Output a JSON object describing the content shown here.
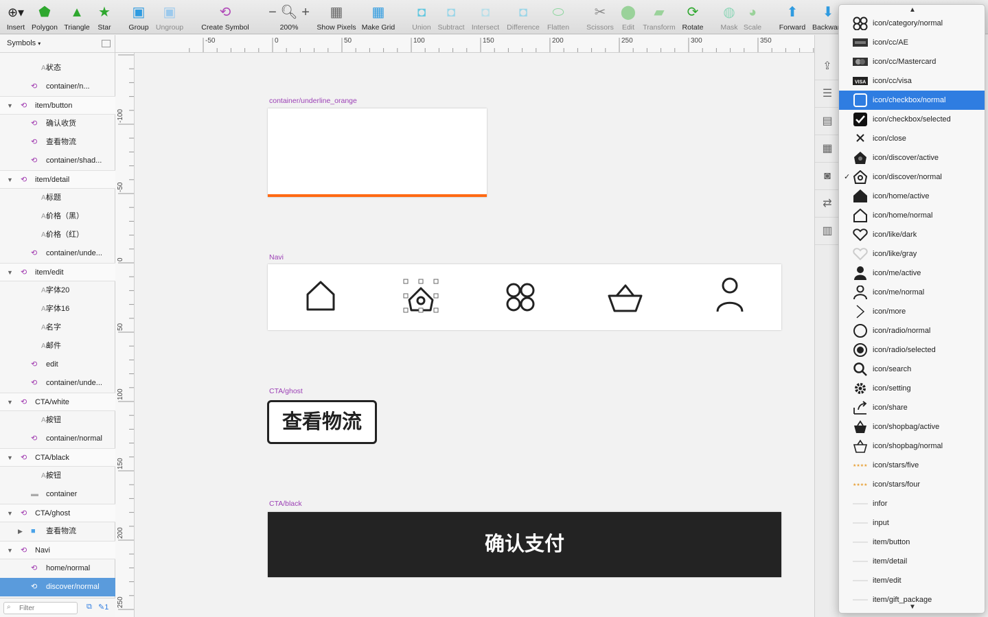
{
  "toolbar": {
    "insert": "Insert",
    "polygon": "Polygon",
    "triangle": "Triangle",
    "star": "Star",
    "group": "Group",
    "ungroup": "Ungroup",
    "create_symbol": "Create Symbol",
    "zoom": "200%",
    "show_pixels": "Show Pixels",
    "make_grid": "Make Grid",
    "union": "Union",
    "subtract": "Subtract",
    "intersect": "Intersect",
    "difference": "Difference",
    "flatten": "Flatten",
    "scissors": "Scissors",
    "edit": "Edit",
    "transform": "Transform",
    "rotate": "Rotate",
    "mask": "Mask",
    "scale": "Scale",
    "forward": "Forward",
    "backward": "Backward"
  },
  "sidebar": {
    "header": "Symbols",
    "filter_placeholder": "Filter",
    "layers": [
      {
        "label": "状态",
        "kind": "text",
        "depth": 2
      },
      {
        "label": "container/n...",
        "kind": "symbol",
        "depth": 2
      },
      {
        "label": "item/button",
        "kind": "symbol",
        "depth": 1,
        "group": true
      },
      {
        "label": "确认收货",
        "kind": "symbol",
        "depth": 2
      },
      {
        "label": "查看物流",
        "kind": "symbol",
        "depth": 2
      },
      {
        "label": "container/shad...",
        "kind": "symbol",
        "depth": 2
      },
      {
        "label": "item/detail",
        "kind": "symbol",
        "depth": 1,
        "group": true
      },
      {
        "label": "标题",
        "kind": "text",
        "depth": 2
      },
      {
        "label": "价格（黑）",
        "kind": "text",
        "depth": 2
      },
      {
        "label": "价格（红）",
        "kind": "text",
        "depth": 2
      },
      {
        "label": "container/unde...",
        "kind": "symbol",
        "depth": 2
      },
      {
        "label": "item/edit",
        "kind": "symbol",
        "depth": 1,
        "group": true
      },
      {
        "label": "字体20",
        "kind": "text",
        "depth": 2
      },
      {
        "label": "字体16",
        "kind": "text",
        "depth": 2
      },
      {
        "label": "名字",
        "kind": "text",
        "depth": 2
      },
      {
        "label": "邮件",
        "kind": "text",
        "depth": 2
      },
      {
        "label": "edit",
        "kind": "symbol",
        "depth": 2
      },
      {
        "label": "container/unde...",
        "kind": "symbol",
        "depth": 2
      },
      {
        "label": "CTA/white",
        "kind": "symbol",
        "depth": 1,
        "group": true
      },
      {
        "label": "按钮",
        "kind": "text",
        "depth": 2
      },
      {
        "label": "container/normal",
        "kind": "symbol",
        "depth": 2
      },
      {
        "label": "CTA/black",
        "kind": "symbol",
        "depth": 1,
        "group": true
      },
      {
        "label": "按钮",
        "kind": "text",
        "depth": 2
      },
      {
        "label": "container",
        "kind": "line",
        "depth": 2
      },
      {
        "label": "CTA/ghost",
        "kind": "symbol",
        "depth": 1,
        "group": true
      },
      {
        "label": "查看物流",
        "kind": "folder",
        "depth": 2
      },
      {
        "label": "Navi",
        "kind": "symbol",
        "depth": 1,
        "group": true
      },
      {
        "label": "home/normal",
        "kind": "symbol",
        "depth": 2
      },
      {
        "label": "discover/normal",
        "kind": "symbol",
        "depth": 2,
        "selected": true
      }
    ]
  },
  "ruler": {
    "h": [
      "-50",
      "0",
      "50",
      "100",
      "150",
      "200",
      "250",
      "300",
      "350"
    ],
    "v": [
      "-100",
      "-50",
      "0",
      "50",
      "100",
      "150",
      "200",
      "250"
    ]
  },
  "canvas": {
    "artboard1_title": "container/underline_orange",
    "artboard2_title": "Navi",
    "artboard3_title": "CTA/ghost",
    "ghost_text": "查看物流",
    "artboard4_title": "CTA/black",
    "black_text": "确认支付",
    "accent_orange": "#ff6a13"
  },
  "dropdown": {
    "items": [
      {
        "label": "icon/category/normal",
        "icon": "category-icon"
      },
      {
        "label": "icon/cc/AE",
        "icon": "card-ae-icon"
      },
      {
        "label": "icon/cc/Mastercard",
        "icon": "card-mastercard-icon"
      },
      {
        "label": "icon/cc/visa",
        "icon": "card-visa-icon"
      },
      {
        "label": "icon/checkbox/normal",
        "icon": "checkbox-icon",
        "highlighted": true
      },
      {
        "label": "icon/checkbox/selected",
        "icon": "checkbox-selected-icon"
      },
      {
        "label": "icon/close",
        "icon": "close-icon"
      },
      {
        "label": "icon/discover/active",
        "icon": "discover-active-icon"
      },
      {
        "label": "icon/discover/normal",
        "icon": "discover-icon",
        "checked": true
      },
      {
        "label": "icon/home/active",
        "icon": "home-active-icon"
      },
      {
        "label": "icon/home/normal",
        "icon": "home-icon"
      },
      {
        "label": "icon/like/dark",
        "icon": "heart-icon"
      },
      {
        "label": "icon/like/gray",
        "icon": "heart-gray-icon"
      },
      {
        "label": "icon/me/active",
        "icon": "person-active-icon"
      },
      {
        "label": "icon/me/normal",
        "icon": "person-icon"
      },
      {
        "label": "icon/more",
        "icon": "chevron-right-icon"
      },
      {
        "label": "icon/radio/normal",
        "icon": "radio-icon"
      },
      {
        "label": "icon/radio/selected",
        "icon": "radio-selected-icon"
      },
      {
        "label": "icon/search",
        "icon": "search-icon"
      },
      {
        "label": "icon/setting",
        "icon": "gear-icon"
      },
      {
        "label": "icon/share",
        "icon": "share-icon"
      },
      {
        "label": "icon/shopbag/active",
        "icon": "bag-active-icon"
      },
      {
        "label": "icon/shopbag/normal",
        "icon": "bag-icon"
      },
      {
        "label": "icon/stars/five",
        "icon": "stars-icon"
      },
      {
        "label": "icon/stars/four",
        "icon": "stars-icon"
      },
      {
        "label": "infor",
        "icon": "line-icon"
      },
      {
        "label": "input",
        "icon": "line-icon"
      },
      {
        "label": "item/button",
        "icon": "line-icon"
      },
      {
        "label": "item/detail",
        "icon": "line-icon"
      },
      {
        "label": "item/edit",
        "icon": "line-icon"
      },
      {
        "label": "item/gift_package",
        "icon": "line-icon"
      }
    ]
  }
}
